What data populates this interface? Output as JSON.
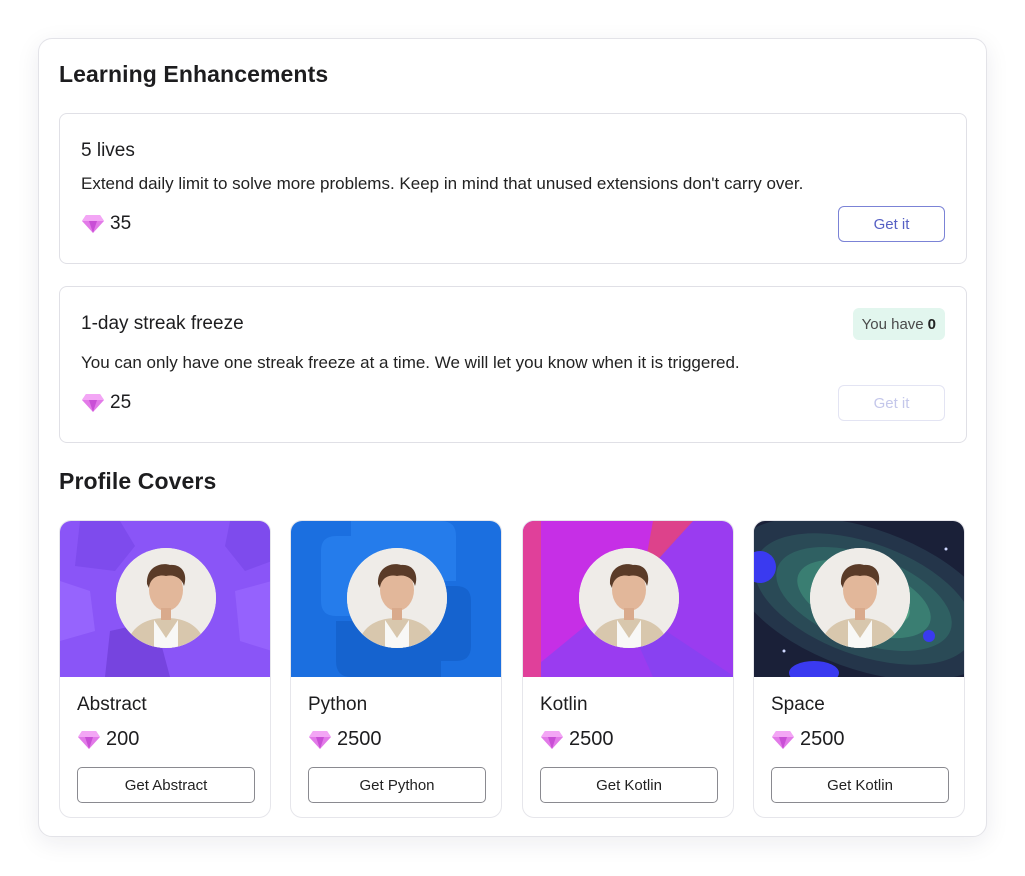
{
  "sections": {
    "enhancements_title": "Learning Enhancements",
    "covers_title": "Profile Covers"
  },
  "enhancements": [
    {
      "title": "5 lives",
      "description": "Extend daily limit to solve more problems. Keep in mind that unused extensions don't carry over.",
      "price": "35",
      "button": "Get it",
      "button_state": "enabled"
    },
    {
      "title": "1-day streak freeze",
      "description": "You can only have one streak freeze at a time. We will let you know when it is triggered.",
      "price": "25",
      "button": "Get it",
      "button_state": "disabled",
      "badge_label": "You have",
      "badge_count": "0"
    }
  ],
  "covers": [
    {
      "name": "Abstract",
      "price": "200",
      "button": "Get Abstract"
    },
    {
      "name": "Python",
      "price": "2500",
      "button": "Get Python"
    },
    {
      "name": "Kotlin",
      "price": "2500",
      "button": "Get Kotlin"
    },
    {
      "name": "Space",
      "price": "2500",
      "button": "Get Kotlin"
    }
  ],
  "colors": {
    "accent": "#5660c4",
    "gem": "#d85ce0",
    "badge_bg": "#e2f6ee",
    "abstract_bg": "#8a55f7",
    "python_bg": "#1b6fe0",
    "kotlin_bg": "#b62ef0",
    "space_bg": "#2b6e6a"
  },
  "icons": {
    "gem": "gem-icon"
  }
}
